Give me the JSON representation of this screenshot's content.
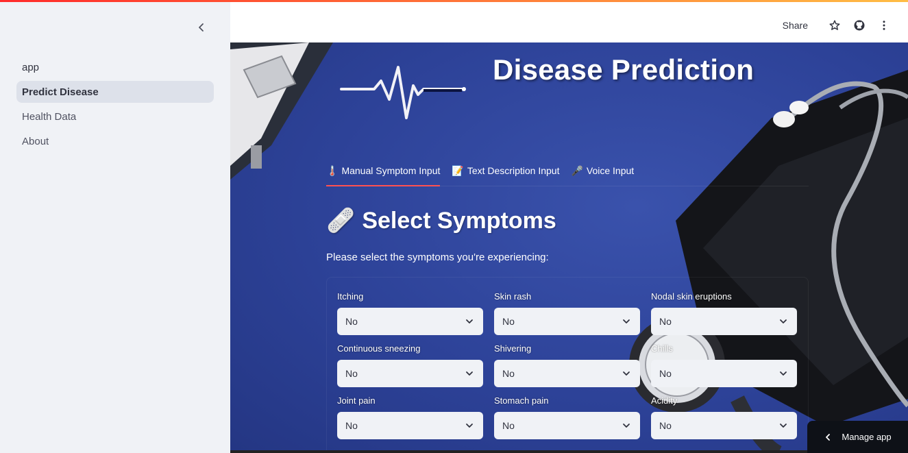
{
  "sidebar": {
    "items": [
      {
        "label": "app"
      },
      {
        "label": "Predict Disease"
      },
      {
        "label": "Health Data"
      },
      {
        "label": "About"
      }
    ]
  },
  "header": {
    "share_label": "Share"
  },
  "main": {
    "title": "Disease Prediction",
    "tabs": [
      {
        "emoji": "🌡️",
        "label": "Manual Symptom Input"
      },
      {
        "emoji": "📝",
        "label": "Text Description Input"
      },
      {
        "emoji": "🎤",
        "label": "Voice Input"
      }
    ],
    "section_emoji": "🩹",
    "section_title": "Select Symptoms",
    "subtitle": "Please select the symptoms you're experiencing:",
    "fields": [
      {
        "label": "Itching",
        "value": "No"
      },
      {
        "label": "Skin rash",
        "value": "No"
      },
      {
        "label": "Nodal skin eruptions",
        "value": "No"
      },
      {
        "label": "Continuous sneezing",
        "value": "No"
      },
      {
        "label": "Shivering",
        "value": "No"
      },
      {
        "label": "Chills",
        "value": "No"
      },
      {
        "label": "Joint pain",
        "value": "No"
      },
      {
        "label": "Stomach pain",
        "value": "No"
      },
      {
        "label": "Acidity",
        "value": "No"
      }
    ]
  },
  "manage_app_label": "Manage app",
  "colors": {
    "accent": "#ff4b4b",
    "main_bg": "#2d4298",
    "sidebar_bg": "#f0f2f6"
  }
}
